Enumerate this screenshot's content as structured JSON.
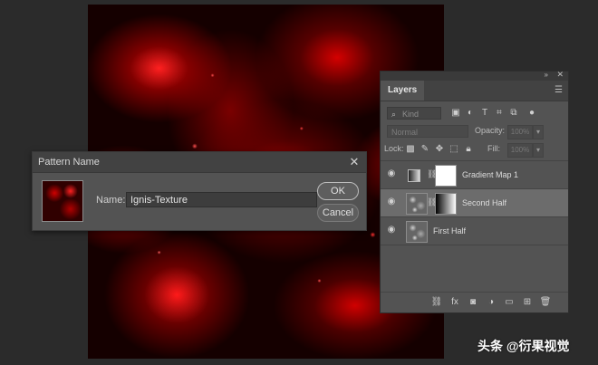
{
  "dialog": {
    "title": "Pattern Name",
    "name_label": "Name:",
    "name_value": "Ignis-Texture",
    "ok_label": "OK",
    "cancel_label": "Cancel",
    "close_glyph": "✕"
  },
  "layers_panel": {
    "tab_label": "Layers",
    "kind_placeholder": "Kind",
    "blend_mode": "Normal",
    "opacity_label": "Opacity:",
    "opacity_value": "100%",
    "lock_label": "Lock:",
    "fill_label": "Fill:",
    "fill_value": "100%",
    "layers": [
      {
        "name": "Gradient Map 1",
        "selected": false
      },
      {
        "name": "Second Half",
        "selected": true
      },
      {
        "name": "First Half",
        "selected": false
      }
    ]
  },
  "watermark": "头条 @衍果视觉",
  "colors": {
    "panel_bg": "#535353",
    "app_bg": "#2b2b2b",
    "selected_row": "#6c6c6c",
    "texture_red": "#d00000"
  }
}
